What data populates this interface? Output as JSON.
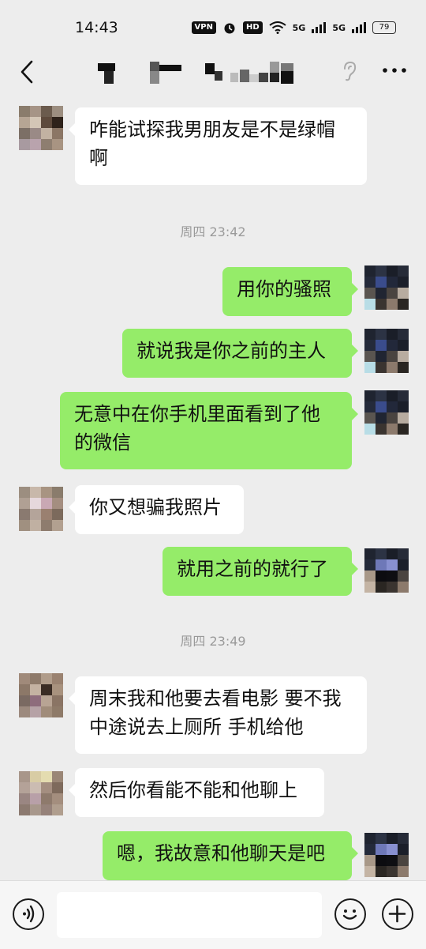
{
  "status_bar": {
    "time": "14:43",
    "vpn_label": "VPN",
    "hd_label": "HD",
    "network_1": "5G",
    "network_2": "5G",
    "battery": "79"
  },
  "nav": {
    "back_icon": "chevron-left-icon",
    "ear_icon": "ear-icon",
    "more_icon": "more-horizontal-icon"
  },
  "messages": [
    {
      "type": "in",
      "text": "咋能试探我男朋友是不是绿帽啊"
    },
    {
      "type": "time",
      "text": "周四 23:42"
    },
    {
      "type": "out",
      "text": "用你的骚照"
    },
    {
      "type": "out",
      "text": "就说我是你之前的主人"
    },
    {
      "type": "out",
      "text": "无意中在你手机里面看到了他的微信"
    },
    {
      "type": "in",
      "text": "你又想骗我照片"
    },
    {
      "type": "out",
      "text": "就用之前的就行了"
    },
    {
      "type": "time",
      "text": "周四 23:49"
    },
    {
      "type": "in",
      "text": "周末我和他要去看电影 要不我中途说去上厕所 手机给他"
    },
    {
      "type": "in",
      "text": "然后你看能不能和他聊上"
    },
    {
      "type": "out",
      "text": "嗯，我故意和他聊天是吧"
    }
  ],
  "input_bar": {
    "value": "",
    "voice_icon": "voice-icon",
    "emoji_icon": "emoji-icon",
    "plus_icon": "plus-icon"
  },
  "colors": {
    "background": "#ededed",
    "bubble_out": "#95ec69",
    "bubble_in": "#ffffff",
    "timestamp": "#9a9a9a"
  }
}
